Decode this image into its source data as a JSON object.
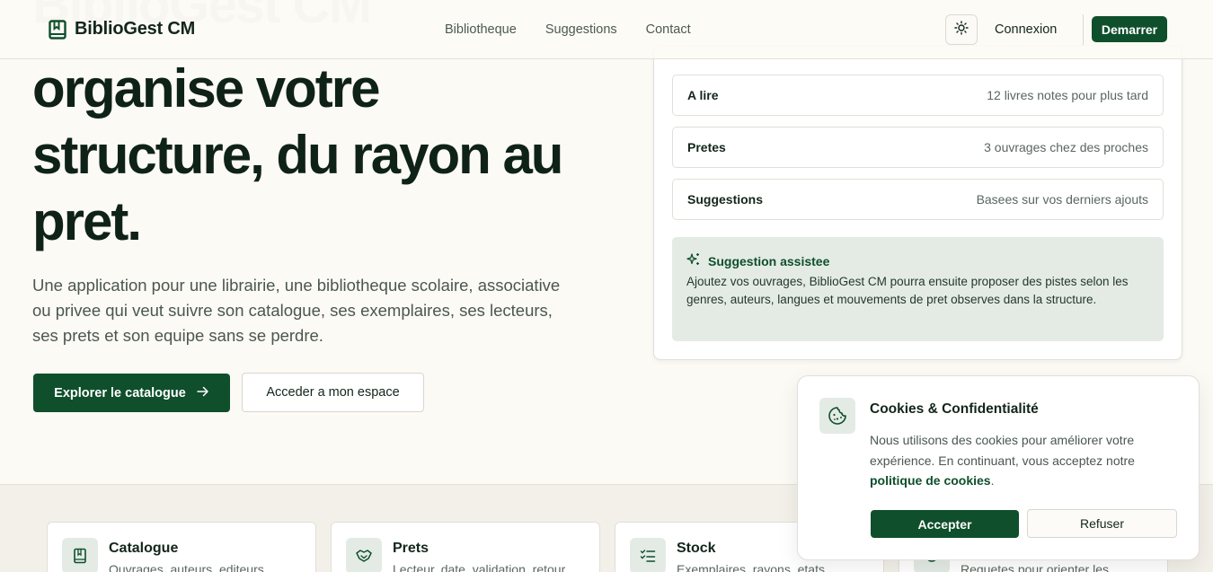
{
  "header": {
    "brand": "BiblioGest CM",
    "nav": [
      "Bibliotheque",
      "Suggestions",
      "Contact"
    ],
    "login": "Connexion",
    "start": "Demarrer",
    "theme_icon": "sun-icon"
  },
  "hero": {
    "title_lines": [
      "organise votre",
      "structure, du rayon au",
      "pret."
    ],
    "description": "Une application pour une librairie, une bibliotheque scolaire, associative ou privee qui veut suivre son catalogue, ses exemplaires, ses lecteurs, ses prets et son equipe sans se perdre.",
    "cta_primary": "Explorer le catalogue",
    "cta_secondary": "Acceder a mon espace"
  },
  "panel": {
    "rows": [
      {
        "label": "A lire",
        "value": "12 livres notes pour plus tard"
      },
      {
        "label": "Pretes",
        "value": "3 ouvrages chez des proches"
      },
      {
        "label": "Suggestions",
        "value": "Basees sur vos derniers ajouts"
      }
    ],
    "assist": {
      "title": "Suggestion assistee",
      "text": "Ajoutez vos ouvrages, BiblioGest CM pourra ensuite proposer des pistes selon les genres, auteurs, langues et mouvements de pret observes dans la structure."
    }
  },
  "features": [
    {
      "title": "Catalogue",
      "desc": "Ouvrages, auteurs, editeurs",
      "icon": "book-icon"
    },
    {
      "title": "Prets",
      "desc": "Lecteur, date, validation, retour",
      "icon": "handshake-icon"
    },
    {
      "title": "Stock",
      "desc": "Exemplaires, rayons, etats",
      "icon": "checklist-icon"
    },
    {
      "title": "",
      "desc": "Requetes pour orienter les",
      "icon": "request-icon"
    }
  ],
  "cookie": {
    "title": "Cookies & Confidentialité",
    "text_before": "Nous utilisons des cookies pour améliorer votre expérience. En continuant, vous acceptez notre",
    "link": "politique de cookies",
    "text_after": ".",
    "accept": "Accepter",
    "refuse": "Refuser"
  },
  "colors": {
    "accent": "#0f4f2c",
    "background": "#fcfaf5",
    "soft": "#e4ebe5"
  }
}
